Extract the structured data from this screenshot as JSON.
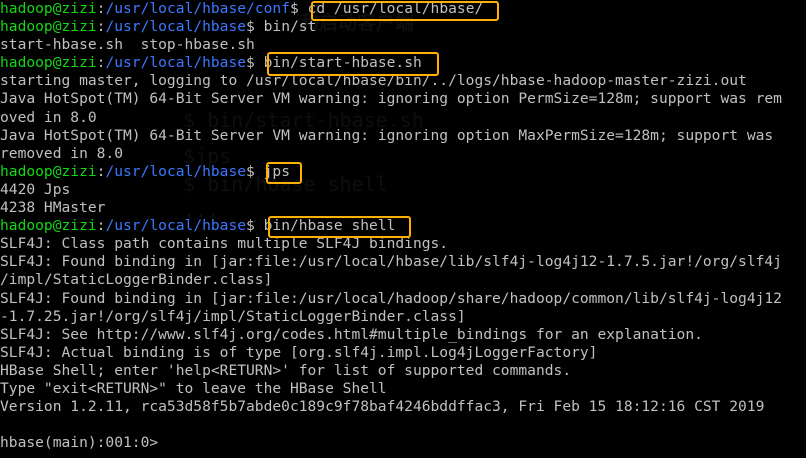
{
  "window": {
    "background": "#000000",
    "colors": {
      "text": "#c0c0c0",
      "user_host": "#13d713",
      "path": "#3b78ff",
      "highlight": "#ffb000"
    }
  },
  "background_ghost_text": {
    "title": "和启动客户端",
    "commands": [
      "$ bin/start-hbase.sh",
      "$jps",
      "$ bin/hbase shell",
      "..."
    ]
  },
  "lines": [
    {
      "user": "hadoop@zizi",
      "sep": ":",
      "path": "/usr/local/hbase/conf",
      "prompt_end": "$ ",
      "cmd": "cd /usr/local/hbase/",
      "text": ""
    },
    {
      "user": "hadoop@zizi",
      "sep": ":",
      "path": "/usr/local/hbase",
      "prompt_end": "$ ",
      "cmd": "bin/st",
      "text": ""
    },
    {
      "user": "",
      "sep": "",
      "path": "",
      "prompt_end": "",
      "cmd": "",
      "text": "start-hbase.sh  stop-hbase.sh"
    },
    {
      "user": "hadoop@zizi",
      "sep": ":",
      "path": "/usr/local/hbase",
      "prompt_end": "$ ",
      "cmd": "bin/start-hbase.sh",
      "text": ""
    },
    {
      "user": "",
      "sep": "",
      "path": "",
      "prompt_end": "",
      "cmd": "",
      "text": "starting master, logging to /usr/local/hbase/bin/../logs/hbase-hadoop-master-zizi.out"
    },
    {
      "user": "",
      "sep": "",
      "path": "",
      "prompt_end": "",
      "cmd": "",
      "text": "Java HotSpot(TM) 64-Bit Server VM warning: ignoring option PermSize=128m; support was rem"
    },
    {
      "user": "",
      "sep": "",
      "path": "",
      "prompt_end": "",
      "cmd": "",
      "text": "oved in 8.0"
    },
    {
      "user": "",
      "sep": "",
      "path": "",
      "prompt_end": "",
      "cmd": "",
      "text": "Java HotSpot(TM) 64-Bit Server VM warning: ignoring option MaxPermSize=128m; support was"
    },
    {
      "user": "",
      "sep": "",
      "path": "",
      "prompt_end": "",
      "cmd": "",
      "text": "removed in 8.0"
    },
    {
      "user": "hadoop@zizi",
      "sep": ":",
      "path": "/usr/local/hbase",
      "prompt_end": "$ ",
      "cmd": "jps",
      "text": ""
    },
    {
      "user": "",
      "sep": "",
      "path": "",
      "prompt_end": "",
      "cmd": "",
      "text": "4420 Jps"
    },
    {
      "user": "",
      "sep": "",
      "path": "",
      "prompt_end": "",
      "cmd": "",
      "text": "4238 HMaster"
    },
    {
      "user": "hadoop@zizi",
      "sep": ":",
      "path": "/usr/local/hbase",
      "prompt_end": "$ ",
      "cmd": "bin/hbase shell",
      "text": ""
    },
    {
      "user": "",
      "sep": "",
      "path": "",
      "prompt_end": "",
      "cmd": "",
      "text": "SLF4J: Class path contains multiple SLF4J bindings."
    },
    {
      "user": "",
      "sep": "",
      "path": "",
      "prompt_end": "",
      "cmd": "",
      "text": "SLF4J: Found binding in [jar:file:/usr/local/hbase/lib/slf4j-log4j12-1.7.5.jar!/org/slf4j"
    },
    {
      "user": "",
      "sep": "",
      "path": "",
      "prompt_end": "",
      "cmd": "",
      "text": "/impl/StaticLoggerBinder.class]"
    },
    {
      "user": "",
      "sep": "",
      "path": "",
      "prompt_end": "",
      "cmd": "",
      "text": "SLF4J: Found binding in [jar:file:/usr/local/hadoop/share/hadoop/common/lib/slf4j-log4j12"
    },
    {
      "user": "",
      "sep": "",
      "path": "",
      "prompt_end": "",
      "cmd": "",
      "text": "-1.7.25.jar!/org/slf4j/impl/StaticLoggerBinder.class]"
    },
    {
      "user": "",
      "sep": "",
      "path": "",
      "prompt_end": "",
      "cmd": "",
      "text": "SLF4J: See http://www.slf4j.org/codes.html#multiple_bindings for an explanation."
    },
    {
      "user": "",
      "sep": "",
      "path": "",
      "prompt_end": "",
      "cmd": "",
      "text": "SLF4J: Actual binding is of type [org.slf4j.impl.Log4jLoggerFactory]"
    },
    {
      "user": "",
      "sep": "",
      "path": "",
      "prompt_end": "",
      "cmd": "",
      "text": "HBase Shell; enter 'help<RETURN>' for list of supported commands."
    },
    {
      "user": "",
      "sep": "",
      "path": "",
      "prompt_end": "",
      "cmd": "",
      "text": "Type \"exit<RETURN>\" to leave the HBase Shell"
    },
    {
      "user": "",
      "sep": "",
      "path": "",
      "prompt_end": "",
      "cmd": "",
      "text": "Version 1.2.11, rca53d58f5b7abde0c189c9f78baf4246bddffac3, Fri Feb 15 18:12:16 CST 2019"
    },
    {
      "user": "",
      "sep": "",
      "path": "",
      "prompt_end": "",
      "cmd": "",
      "text": ""
    },
    {
      "user": "",
      "sep": "",
      "path": "",
      "prompt_end": "",
      "cmd": "",
      "text": "hbase(main):001:0>"
    }
  ]
}
